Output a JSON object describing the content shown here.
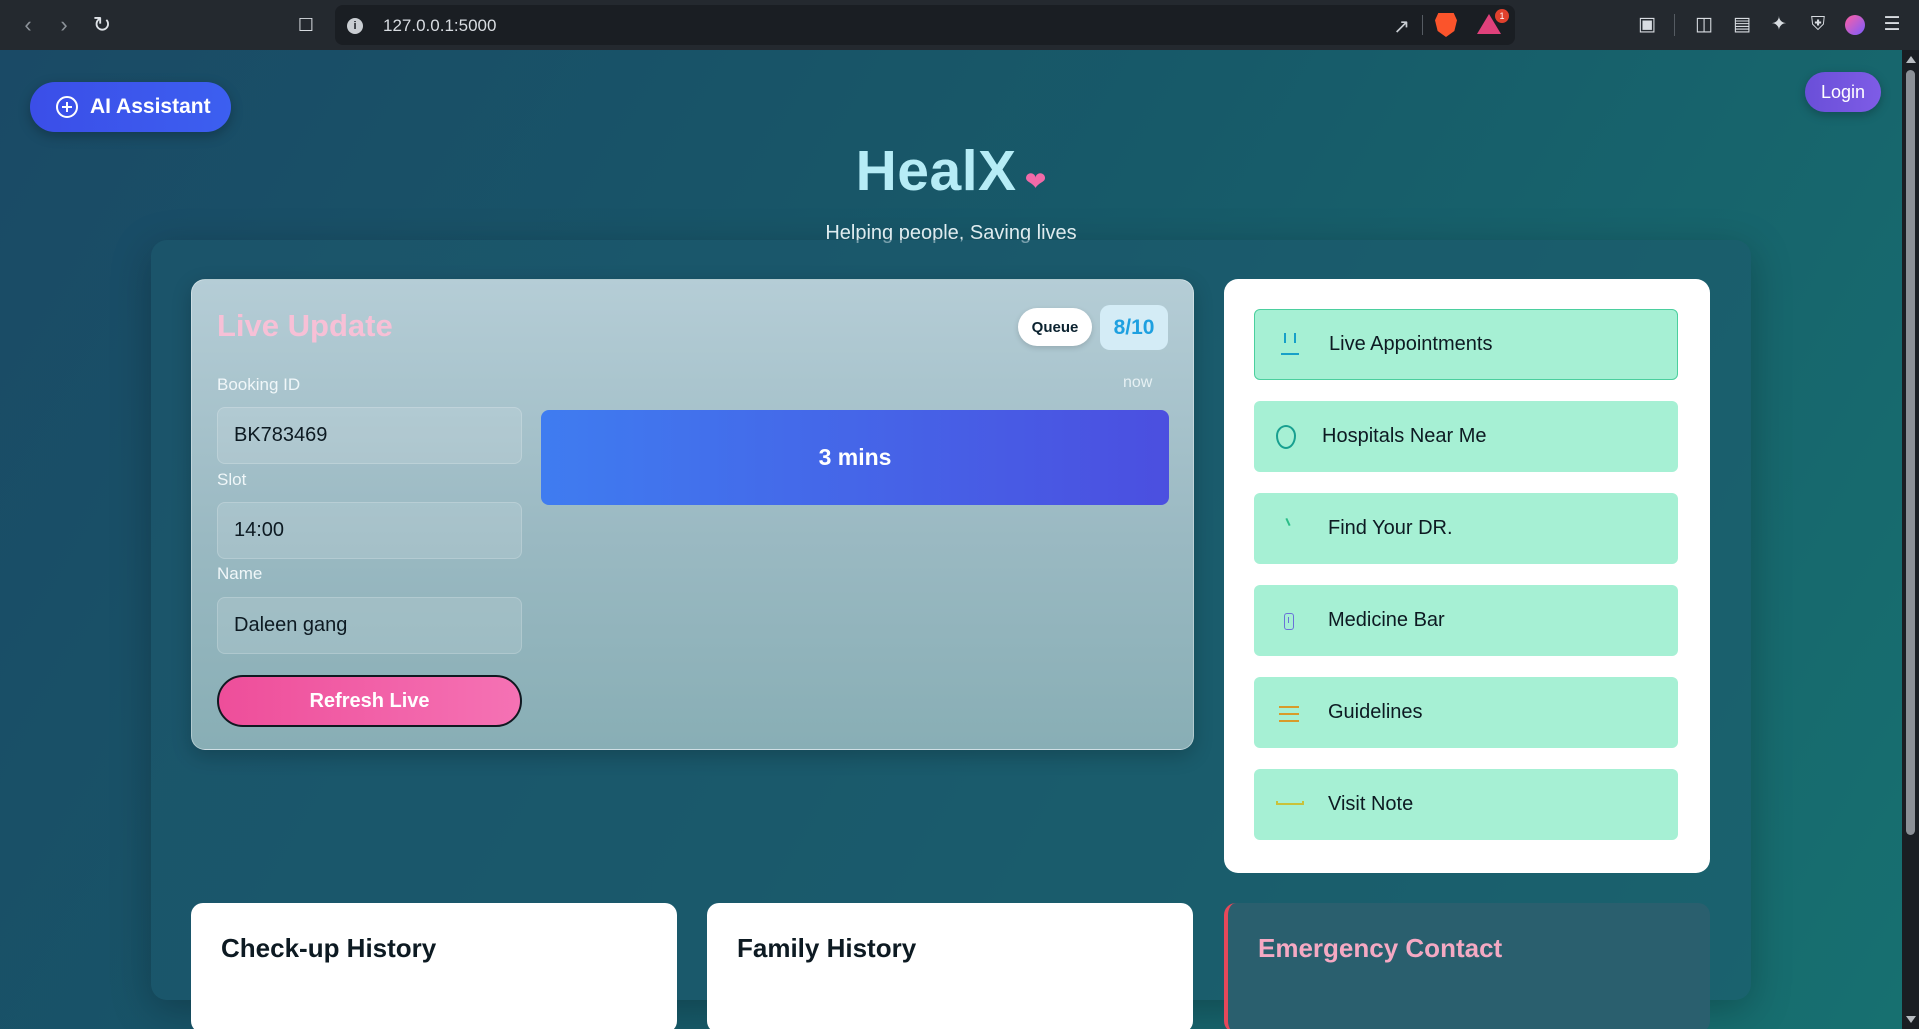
{
  "browser": {
    "url": "127.0.0.1:5000",
    "rewards_badge": "1"
  },
  "header": {
    "ai_assistant_label": "AI Assistant",
    "login_label": "Login",
    "brand_title": "HealX",
    "tagline": "Helping people, Saving lives"
  },
  "live_update": {
    "title": "Live Update",
    "queue_label": "Queue",
    "queue_count": "8/10",
    "booking_id_label": "Booking ID",
    "booking_id": "BK783469",
    "slot_label": "Slot",
    "slot": "14:00",
    "name_label": "Name",
    "name": "Daleen gang",
    "timestamp": "now",
    "eta": "3 mins",
    "refresh_label": "Refresh Live"
  },
  "menu": {
    "items": [
      {
        "label": "Live Appointments",
        "icon": "appointments-icon"
      },
      {
        "label": "Hospitals Near Me",
        "icon": "location-pin-icon"
      },
      {
        "label": "Find Your DR.",
        "icon": "doctor-icon"
      },
      {
        "label": "Medicine Bar",
        "icon": "medicine-icon"
      },
      {
        "label": "Guidelines",
        "icon": "list-icon"
      },
      {
        "label": "Visit Note",
        "icon": "note-icon"
      }
    ]
  },
  "sections": {
    "checkup_history": "Check-up History",
    "family_history": "Family History",
    "emergency_contact": "Emergency Contact"
  },
  "colors": {
    "accent_blue": "#3b4ee8",
    "accent_pink": "#ee4e9a",
    "menu_item_bg": "#a6f0d4",
    "brand_title": "#b6ecf6"
  }
}
